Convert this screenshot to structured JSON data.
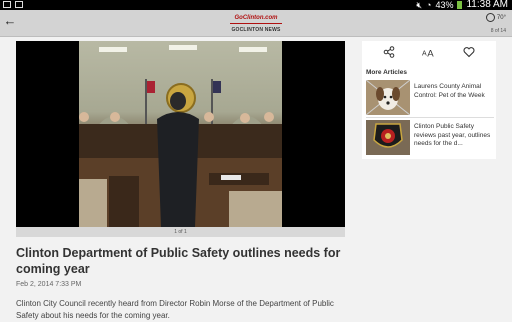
{
  "status_bar": {
    "battery": "43%",
    "time": "11:38 AM"
  },
  "header": {
    "logo_text": "GoClinton.com",
    "section": "GOCLINTON NEWS",
    "temperature": "70°",
    "page_count": "8 of 14"
  },
  "article": {
    "photo_caption": "1 of 1",
    "headline": "Clinton Department of Public Safety outlines needs for coming year",
    "date": "Feb 2, 2014 7:33 PM",
    "body": "Clinton City Council recently heard from Director Robin Morse of the Department of Public Safety about his needs for the coming year."
  },
  "sidebar": {
    "more_title": "More Articles",
    "items": [
      {
        "label": "Laurens County Animal Control: Pet of the Week"
      },
      {
        "label": "Clinton Public Safety reviews past year, outlines needs for the d..."
      }
    ]
  },
  "colors": {
    "action_bar": "#d3d3d3",
    "page_bg": "#f2f2f2",
    "logo_red": "#b01010"
  },
  "icons": {
    "back": "arrow-left-icon",
    "weather": "sun-icon",
    "share": "share-icon",
    "text_size": "text-size-icon",
    "favorite": "heart-icon"
  }
}
